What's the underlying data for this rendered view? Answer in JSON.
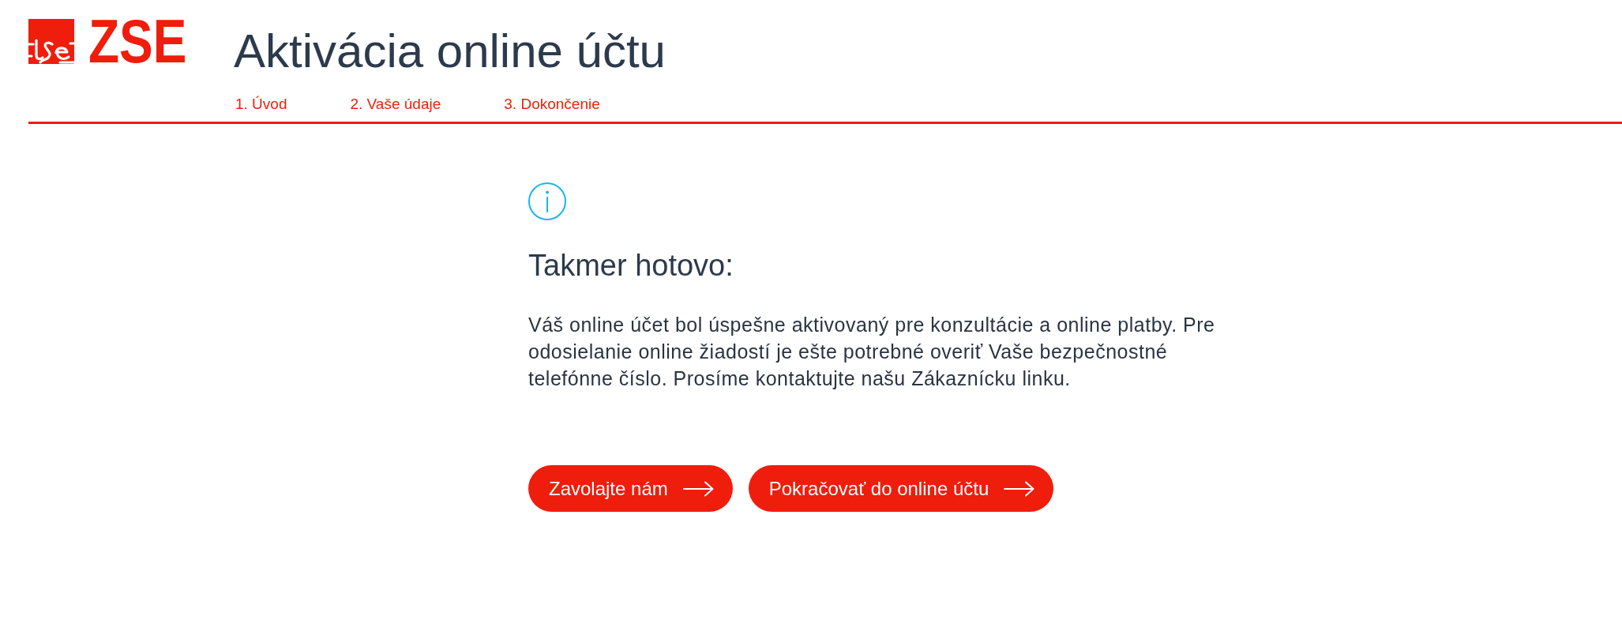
{
  "header": {
    "logo_text": "ZSE",
    "title": "Aktivácia online účtu"
  },
  "steps": [
    "1. Úvod",
    "2. Vaše údaje",
    "3. Dokončenie"
  ],
  "message": {
    "heading": "Takmer hotovo:",
    "text": "Váš online účet bol úspešne aktivovaný pre konzultácie a online platby. Pre odosielanie online žiadostí je ešte potrebné overiť Vaše bezpečnostné telefónne číslo. Prosíme kontaktujte našu Zákaznícku linku."
  },
  "buttons": [
    {
      "label": "Zavolajte nám"
    },
    {
      "label": "Pokračovať do online účtu"
    }
  ]
}
